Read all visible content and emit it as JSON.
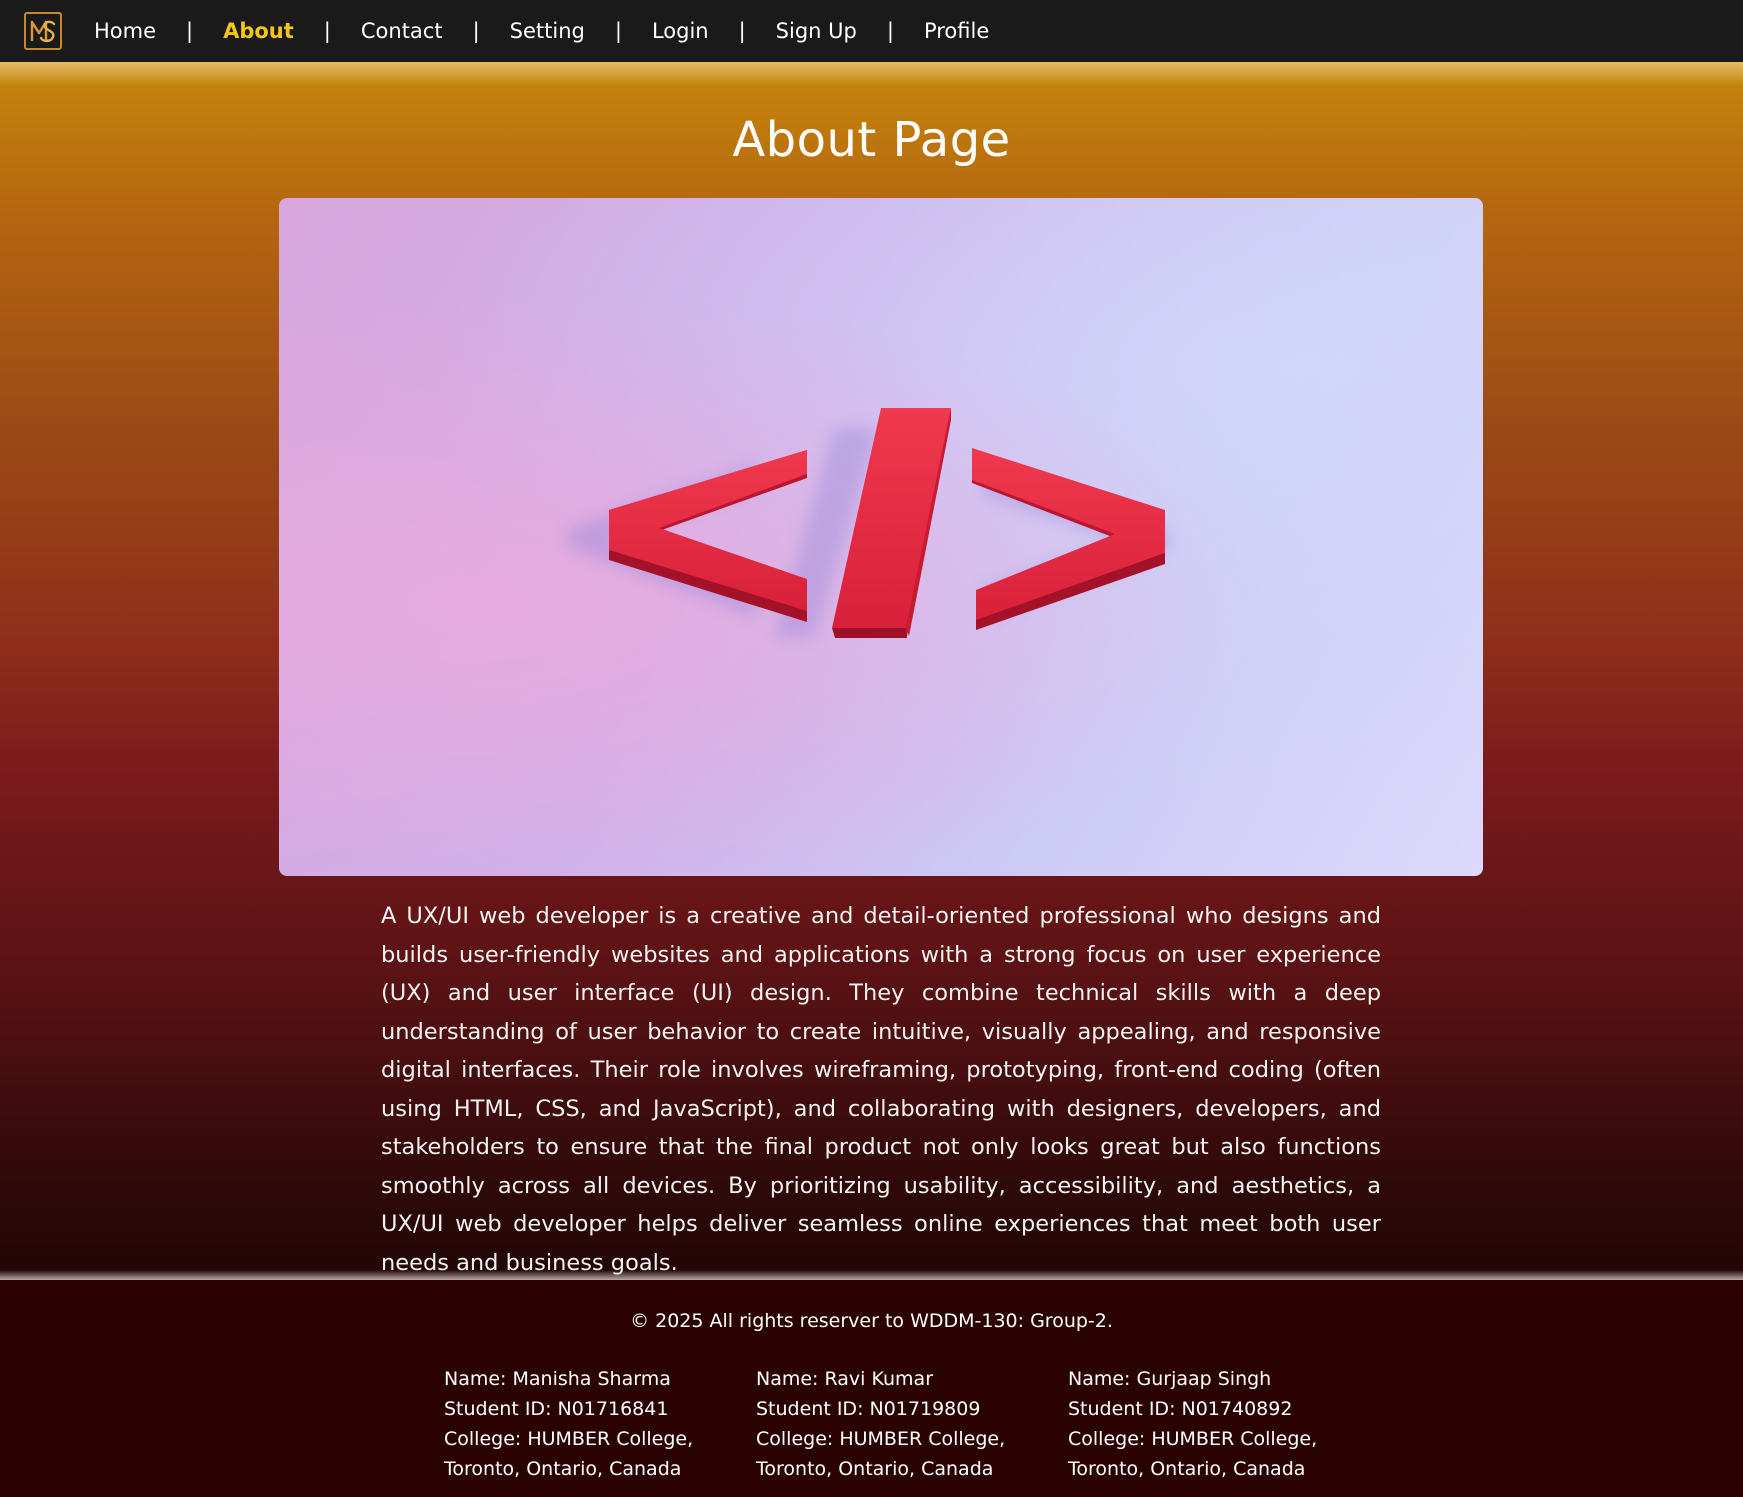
{
  "nav": {
    "logo_icon": "ms-monogram-logo-icon",
    "items": [
      {
        "label": "Home",
        "active": false
      },
      {
        "label": "About",
        "active": true
      },
      {
        "label": "Contact",
        "active": false
      },
      {
        "label": "Setting",
        "active": false
      },
      {
        "label": "Login",
        "active": false
      },
      {
        "label": "Sign Up",
        "active": false
      },
      {
        "label": "Profile",
        "active": false
      }
    ],
    "separator": "|",
    "active_color": "#f5c518"
  },
  "main": {
    "title": "About Page",
    "hero_image": "code-brackets-illustration",
    "paragraph": "A UX/UI web developer is a creative and detail-oriented professional who designs and builds user-friendly websites and applications with a strong focus on user experience (UX) and user interface (UI) design. They combine technical skills with a deep understanding of user behavior to create intuitive, visually appealing, and responsive digital interfaces. Their role involves wireframing, prototyping, front-end coding (often using HTML, CSS, and JavaScript), and collaborating with designers, developers, and stakeholders to ensure that the final product not only looks great but also functions smoothly across all devices. By prioritizing usability, accessibility, and aesthetics, a UX/UI web developer helps deliver seamless online experiences that meet both user needs and business goals."
  },
  "footer": {
    "copyright": "© 2025 All rights reserver to WDDM-130: Group-2.",
    "members": [
      {
        "name": "Name: Manisha Sharma",
        "student_id": "Student ID: N01716841",
        "college": "College: HUMBER College,",
        "location": "Toronto, Ontario, Canada"
      },
      {
        "name": "Name: Ravi Kumar",
        "student_id": "Student ID: N01719809",
        "college": "College: HUMBER College,",
        "location": "Toronto, Ontario, Canada"
      },
      {
        "name": "Name: Gurjaap Singh",
        "student_id": "Student ID: N01740892",
        "college": "College: HUMBER College,",
        "location": "Toronto, Ontario, Canada"
      }
    ]
  }
}
